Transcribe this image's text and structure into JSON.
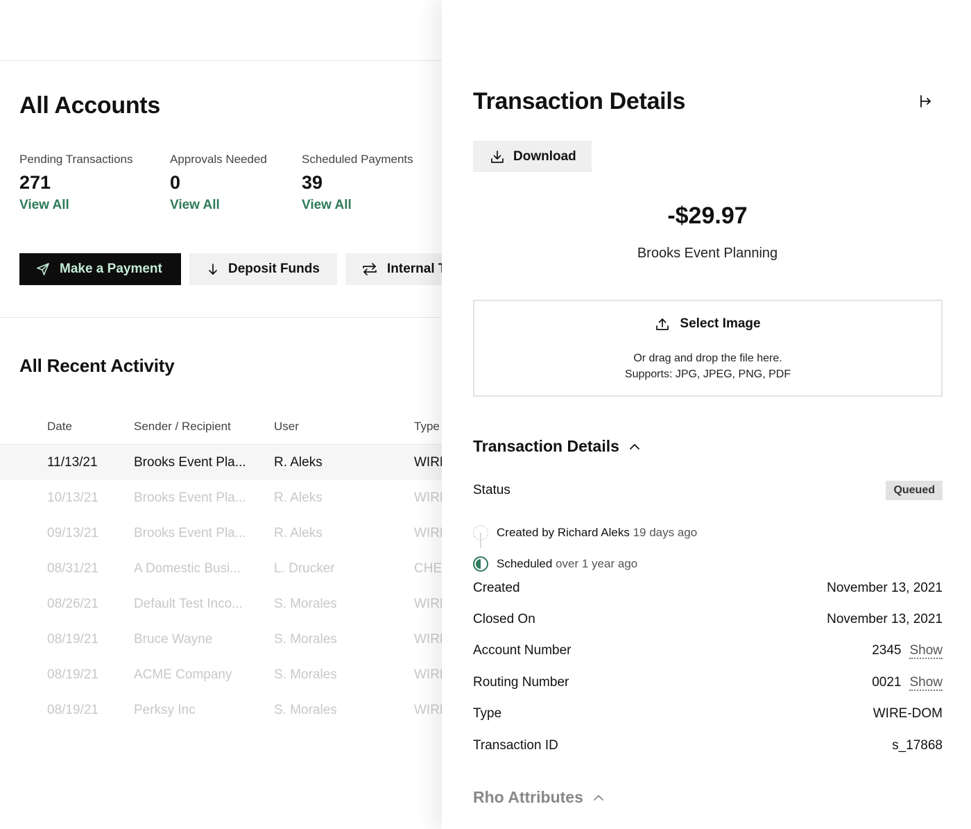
{
  "main": {
    "title": "All Accounts",
    "stats": [
      {
        "label": "Pending Transactions",
        "value": "271",
        "link": "View All"
      },
      {
        "label": "Approvals Needed",
        "value": "0",
        "link": "View All"
      },
      {
        "label": "Scheduled Payments",
        "value": "39",
        "link": "View All"
      }
    ],
    "actions": {
      "make_payment": "Make a Payment",
      "deposit_funds": "Deposit Funds",
      "internal_transfer": "Internal T"
    },
    "activity_title": "All Recent Activity",
    "table": {
      "headers": {
        "date": "Date",
        "sender": "Sender / Recipient",
        "user": "User",
        "type": "Type"
      },
      "rows": [
        {
          "date": "11/13/21",
          "sender": "Brooks Event Pla...",
          "user": "R. Aleks",
          "type": "WIRE"
        },
        {
          "date": "10/13/21",
          "sender": "Brooks Event Pla...",
          "user": "R. Aleks",
          "type": "WIRE"
        },
        {
          "date": "09/13/21",
          "sender": "Brooks Event Pla...",
          "user": "R. Aleks",
          "type": "WIRE"
        },
        {
          "date": "08/31/21",
          "sender": "A Domestic Busi...",
          "user": "L. Drucker",
          "type": "CHE"
        },
        {
          "date": "08/26/21",
          "sender": "Default Test Inco...",
          "user": "S. Morales",
          "type": "WIRE"
        },
        {
          "date": "08/19/21",
          "sender": "Bruce Wayne",
          "user": "S. Morales",
          "type": "WIRE"
        },
        {
          "date": "08/19/21",
          "sender": "ACME Company",
          "user": "S. Morales",
          "type": "WIRE"
        },
        {
          "date": "08/19/21",
          "sender": "Perksy Inc",
          "user": "S. Morales",
          "type": "WIRE"
        }
      ]
    }
  },
  "panel": {
    "title": "Transaction Details",
    "download_label": "Download",
    "amount": "-$29.97",
    "merchant": "Brooks Event Planning",
    "upload": {
      "select_label": "Select Image",
      "help_line1": "Or drag and drop the file here.",
      "help_line2": "Supports: JPG, JPEG, PNG, PDF"
    },
    "details_heading": "Transaction Details",
    "status_label": "Status",
    "status_value": "Queued",
    "timeline": [
      {
        "action": "Created by Richard Aleks",
        "when": "19 days ago"
      },
      {
        "action": "Scheduled",
        "when": "over 1 year ago"
      }
    ],
    "fields": {
      "created_label": "Created",
      "created_value": "November 13, 2021",
      "closed_label": "Closed On",
      "closed_value": "November 13, 2021",
      "account_label": "Account Number",
      "account_value": "2345",
      "routing_label": "Routing Number",
      "routing_value": "0021",
      "show_label": "Show",
      "type_label": "Type",
      "type_value": "WIRE-DOM",
      "txid_label": "Transaction ID",
      "txid_value": "s_17868"
    },
    "rho_heading": "Rho Attributes"
  },
  "colors": {
    "accent_green": "#2e7a5a",
    "primary_button_bg": "#0d0d0d",
    "primary_button_text": "#c4ecd9"
  }
}
